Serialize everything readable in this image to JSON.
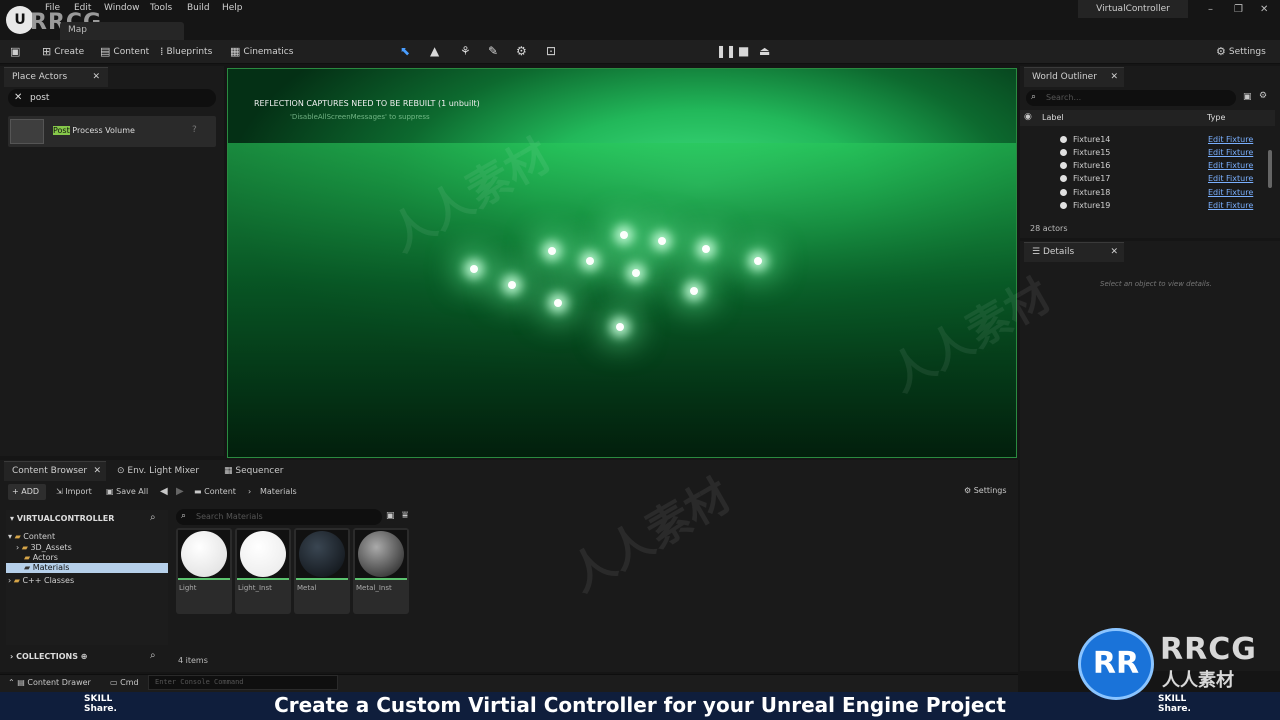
{
  "menu": {
    "items": [
      "File",
      "Edit",
      "Window",
      "Tools",
      "Build",
      "Help"
    ]
  },
  "brand": {
    "watermark": "RRCG",
    "map_tab": "Map"
  },
  "project_title": "VirtualController",
  "toolbar": {
    "create": "Create",
    "content": "Content",
    "blueprints": "Blueprints",
    "cinematics": "Cinematics",
    "settings": "Settings"
  },
  "place_actors": {
    "tab": "Place Actors",
    "search_value": "post",
    "result_highlight": "Post",
    "result_rest": " Process Volume"
  },
  "viewport": {
    "message": "REFLECTION CAPTURES NEED TO BE REBUILT (1 unbuilt)",
    "submessage": "'DisableAllScreenMessages' to suppress"
  },
  "outliner": {
    "tab": "World Outliner",
    "search_placeholder": "Search...",
    "col_label": "Label",
    "col_type": "Type",
    "rows": [
      {
        "label": "Fixture14",
        "type": "Edit Fixture"
      },
      {
        "label": "Fixture15",
        "type": "Edit Fixture"
      },
      {
        "label": "Fixture16",
        "type": "Edit Fixture"
      },
      {
        "label": "Fixture17",
        "type": "Edit Fixture"
      },
      {
        "label": "Fixture18",
        "type": "Edit Fixture"
      },
      {
        "label": "Fixture19",
        "type": "Edit Fixture"
      }
    ],
    "count": "28 actors"
  },
  "details": {
    "tab": "Details",
    "empty": "Select an object to view details."
  },
  "content_browser": {
    "tabs": [
      "Content Browser",
      "Env. Light Mixer",
      "Sequencer"
    ],
    "add": "ADD",
    "import": "Import",
    "save_all": "Save All",
    "path": [
      "Content",
      "Materials"
    ],
    "settings": "Settings",
    "root": "VIRTUALCONTROLLER",
    "tree": [
      "Content",
      "3D_Assets",
      "Actors",
      "Materials",
      "C++ Classes"
    ],
    "search_placeholder": "Search Materials",
    "assets": [
      "Light",
      "Light_Inst",
      "Metal",
      "Metal_Inst"
    ],
    "collections": "COLLECTIONS",
    "item_count": "4 items"
  },
  "statusbar": {
    "drawer": "Content Drawer",
    "cmd": "Cmd",
    "console_placeholder": "Enter Console Command"
  },
  "banner": {
    "title": "Create a Custom Virtial Controller for your Unreal Engine Project",
    "skill_line1": "SKILL",
    "skill_line2": "Share."
  },
  "badge": {
    "logo": "RR",
    "name": "RRCG",
    "sub": "人人素材"
  }
}
